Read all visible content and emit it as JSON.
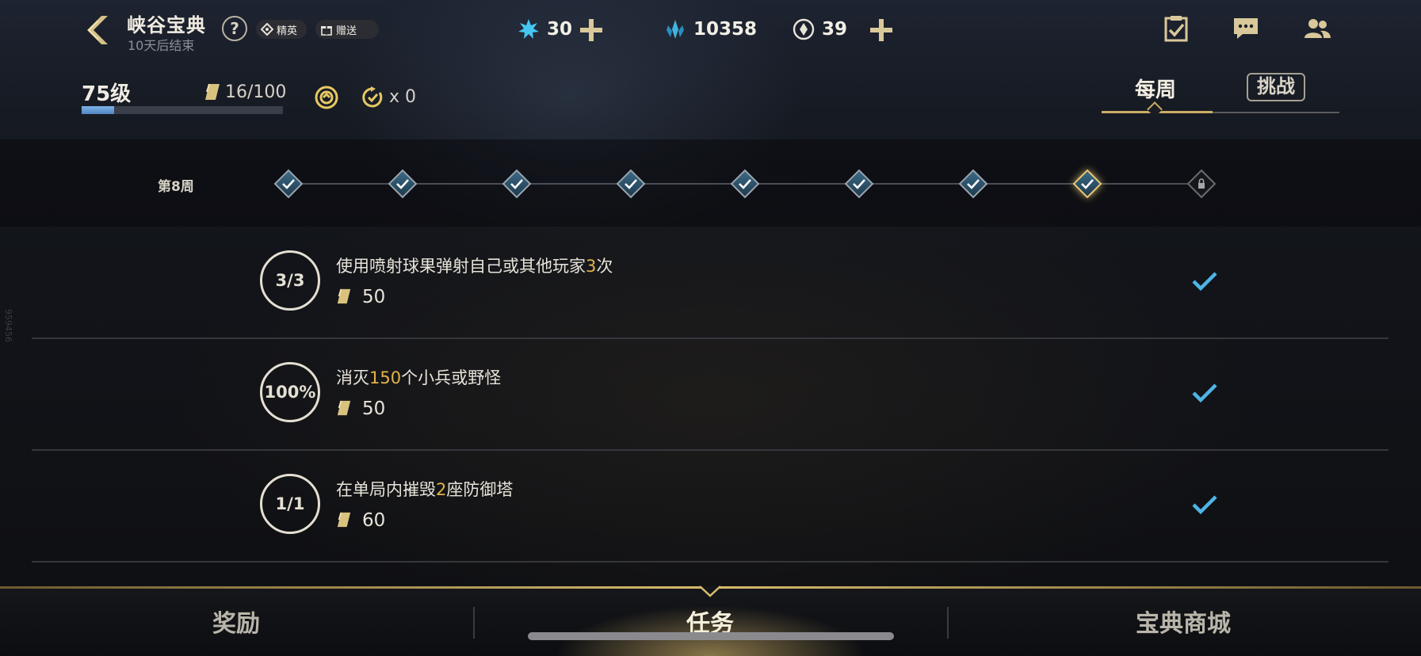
{
  "header": {
    "title": "峡谷宝典",
    "subtitle": "10天后结束",
    "help_label": "?",
    "chips": {
      "elite": "精英",
      "gift": "赠送"
    },
    "currencies": [
      {
        "icon": "blue-essence-icon",
        "value": "30"
      },
      {
        "icon": "crystal-icon",
        "value": "10358"
      },
      {
        "icon": "orange-token-icon",
        "value": "39"
      }
    ],
    "top_icons": [
      "mission-checklist-icon",
      "chat-icon",
      "friends-icon"
    ]
  },
  "progress": {
    "level": "75级",
    "xp_text": "16/100",
    "xp_fraction": 0.16,
    "refresh_count": "x 0"
  },
  "tabs": {
    "weekly": "每周",
    "challenge": "挑战",
    "active": "weekly"
  },
  "weeks": {
    "label": "第8周",
    "nodes": [
      {
        "state": "done"
      },
      {
        "state": "done"
      },
      {
        "state": "done"
      },
      {
        "state": "done"
      },
      {
        "state": "done"
      },
      {
        "state": "done"
      },
      {
        "state": "done"
      },
      {
        "state": "current"
      },
      {
        "state": "locked"
      }
    ]
  },
  "tasks": [
    {
      "badge": "3/3",
      "desc_pre": "使用喷射球果弹射自己或其他玩家",
      "desc_hl": "3",
      "desc_post": "次",
      "reward": "50",
      "done": true
    },
    {
      "badge": "100%",
      "desc_pre": "消灭",
      "desc_hl": "150",
      "desc_post": "个小兵或野怪",
      "reward": "50",
      "done": true
    },
    {
      "badge": "1/1",
      "desc_pre": "在单局内摧毁",
      "desc_hl": "2",
      "desc_post": "座防御塔",
      "reward": "60",
      "done": true
    }
  ],
  "side_watermark": "959456",
  "bottom_nav": {
    "rewards": "奖励",
    "tasks": "任务",
    "shop": "宝典商城",
    "active": "tasks"
  },
  "colors": {
    "accent_gold": "#c9ae62",
    "highlight": "#e2b448",
    "check_blue": "#4fb4e6"
  }
}
